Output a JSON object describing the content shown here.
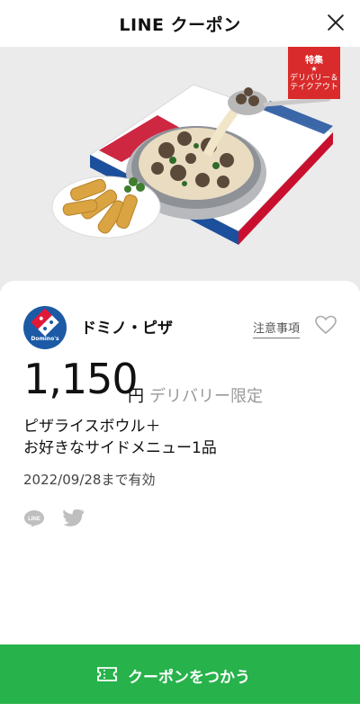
{
  "header": {
    "title": "LINE クーポン"
  },
  "badge": {
    "line1": "特集",
    "star": "★",
    "line2": "デリバリー＆",
    "line3": "テイクアウト"
  },
  "coupon": {
    "brand": "ドミノ・ピザ",
    "notes_label": "注意事項",
    "logo_text": "Domino's",
    "price": "1,150",
    "yen": "円",
    "limit": "デリバリー限定",
    "desc_line1": "ピザライスボウル＋",
    "desc_line2": "お好きなサイドメニュー1品",
    "expiry": "2022/09/28まで有効"
  },
  "share": {
    "line_icon_text": "LINE"
  },
  "cta": {
    "label": "クーポンをつかう"
  },
  "colors": {
    "accent_green": "#27b24b",
    "badge_red": "#d92b2b",
    "brand_blue": "#1c5aa6",
    "brand_red": "#e31837"
  }
}
